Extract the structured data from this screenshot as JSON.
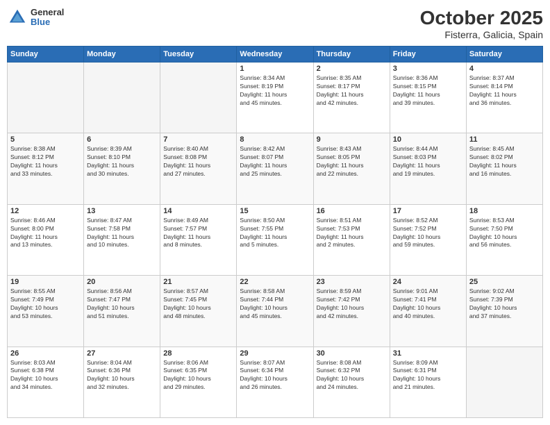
{
  "header": {
    "logo_text_top": "General",
    "logo_text_bottom": "Blue",
    "title": "October 2025",
    "subtitle": "Fisterra, Galicia, Spain"
  },
  "calendar": {
    "days": [
      "Sunday",
      "Monday",
      "Tuesday",
      "Wednesday",
      "Thursday",
      "Friday",
      "Saturday"
    ],
    "weeks": [
      [
        {
          "date": "",
          "info": ""
        },
        {
          "date": "",
          "info": ""
        },
        {
          "date": "",
          "info": ""
        },
        {
          "date": "1",
          "info": "Sunrise: 8:34 AM\nSunset: 8:19 PM\nDaylight: 11 hours\nand 45 minutes."
        },
        {
          "date": "2",
          "info": "Sunrise: 8:35 AM\nSunset: 8:17 PM\nDaylight: 11 hours\nand 42 minutes."
        },
        {
          "date": "3",
          "info": "Sunrise: 8:36 AM\nSunset: 8:15 PM\nDaylight: 11 hours\nand 39 minutes."
        },
        {
          "date": "4",
          "info": "Sunrise: 8:37 AM\nSunset: 8:14 PM\nDaylight: 11 hours\nand 36 minutes."
        }
      ],
      [
        {
          "date": "5",
          "info": "Sunrise: 8:38 AM\nSunset: 8:12 PM\nDaylight: 11 hours\nand 33 minutes."
        },
        {
          "date": "6",
          "info": "Sunrise: 8:39 AM\nSunset: 8:10 PM\nDaylight: 11 hours\nand 30 minutes."
        },
        {
          "date": "7",
          "info": "Sunrise: 8:40 AM\nSunset: 8:08 PM\nDaylight: 11 hours\nand 27 minutes."
        },
        {
          "date": "8",
          "info": "Sunrise: 8:42 AM\nSunset: 8:07 PM\nDaylight: 11 hours\nand 25 minutes."
        },
        {
          "date": "9",
          "info": "Sunrise: 8:43 AM\nSunset: 8:05 PM\nDaylight: 11 hours\nand 22 minutes."
        },
        {
          "date": "10",
          "info": "Sunrise: 8:44 AM\nSunset: 8:03 PM\nDaylight: 11 hours\nand 19 minutes."
        },
        {
          "date": "11",
          "info": "Sunrise: 8:45 AM\nSunset: 8:02 PM\nDaylight: 11 hours\nand 16 minutes."
        }
      ],
      [
        {
          "date": "12",
          "info": "Sunrise: 8:46 AM\nSunset: 8:00 PM\nDaylight: 11 hours\nand 13 minutes."
        },
        {
          "date": "13",
          "info": "Sunrise: 8:47 AM\nSunset: 7:58 PM\nDaylight: 11 hours\nand 10 minutes."
        },
        {
          "date": "14",
          "info": "Sunrise: 8:49 AM\nSunset: 7:57 PM\nDaylight: 11 hours\nand 8 minutes."
        },
        {
          "date": "15",
          "info": "Sunrise: 8:50 AM\nSunset: 7:55 PM\nDaylight: 11 hours\nand 5 minutes."
        },
        {
          "date": "16",
          "info": "Sunrise: 8:51 AM\nSunset: 7:53 PM\nDaylight: 11 hours\nand 2 minutes."
        },
        {
          "date": "17",
          "info": "Sunrise: 8:52 AM\nSunset: 7:52 PM\nDaylight: 10 hours\nand 59 minutes."
        },
        {
          "date": "18",
          "info": "Sunrise: 8:53 AM\nSunset: 7:50 PM\nDaylight: 10 hours\nand 56 minutes."
        }
      ],
      [
        {
          "date": "19",
          "info": "Sunrise: 8:55 AM\nSunset: 7:49 PM\nDaylight: 10 hours\nand 53 minutes."
        },
        {
          "date": "20",
          "info": "Sunrise: 8:56 AM\nSunset: 7:47 PM\nDaylight: 10 hours\nand 51 minutes."
        },
        {
          "date": "21",
          "info": "Sunrise: 8:57 AM\nSunset: 7:45 PM\nDaylight: 10 hours\nand 48 minutes."
        },
        {
          "date": "22",
          "info": "Sunrise: 8:58 AM\nSunset: 7:44 PM\nDaylight: 10 hours\nand 45 minutes."
        },
        {
          "date": "23",
          "info": "Sunrise: 8:59 AM\nSunset: 7:42 PM\nDaylight: 10 hours\nand 42 minutes."
        },
        {
          "date": "24",
          "info": "Sunrise: 9:01 AM\nSunset: 7:41 PM\nDaylight: 10 hours\nand 40 minutes."
        },
        {
          "date": "25",
          "info": "Sunrise: 9:02 AM\nSunset: 7:39 PM\nDaylight: 10 hours\nand 37 minutes."
        }
      ],
      [
        {
          "date": "26",
          "info": "Sunrise: 8:03 AM\nSunset: 6:38 PM\nDaylight: 10 hours\nand 34 minutes."
        },
        {
          "date": "27",
          "info": "Sunrise: 8:04 AM\nSunset: 6:36 PM\nDaylight: 10 hours\nand 32 minutes."
        },
        {
          "date": "28",
          "info": "Sunrise: 8:06 AM\nSunset: 6:35 PM\nDaylight: 10 hours\nand 29 minutes."
        },
        {
          "date": "29",
          "info": "Sunrise: 8:07 AM\nSunset: 6:34 PM\nDaylight: 10 hours\nand 26 minutes."
        },
        {
          "date": "30",
          "info": "Sunrise: 8:08 AM\nSunset: 6:32 PM\nDaylight: 10 hours\nand 24 minutes."
        },
        {
          "date": "31",
          "info": "Sunrise: 8:09 AM\nSunset: 6:31 PM\nDaylight: 10 hours\nand 21 minutes."
        },
        {
          "date": "",
          "info": ""
        }
      ]
    ]
  }
}
